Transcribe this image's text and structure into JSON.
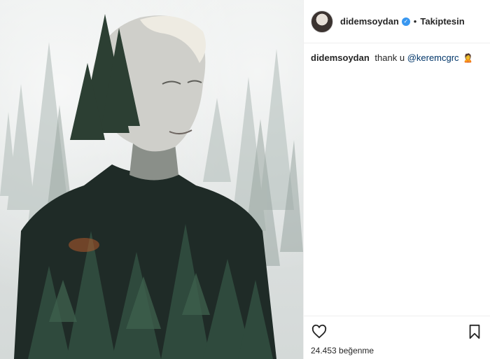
{
  "header": {
    "username": "didemsoydan",
    "separator": "•",
    "follow_state": "Takiptesin"
  },
  "caption": {
    "username": "didemsoydan",
    "text": "thank u ",
    "mention": "@keremcgrc",
    "emoji": "🙎"
  },
  "footer": {
    "likes_count": "24.453",
    "likes_label": "beğenme"
  },
  "icons": {
    "like": "heart-icon",
    "save": "bookmark-icon",
    "verified": "verified-badge-icon"
  },
  "colors": {
    "verified": "#3897f0",
    "mention": "#003569",
    "text": "#262626",
    "divider": "#efefef"
  }
}
